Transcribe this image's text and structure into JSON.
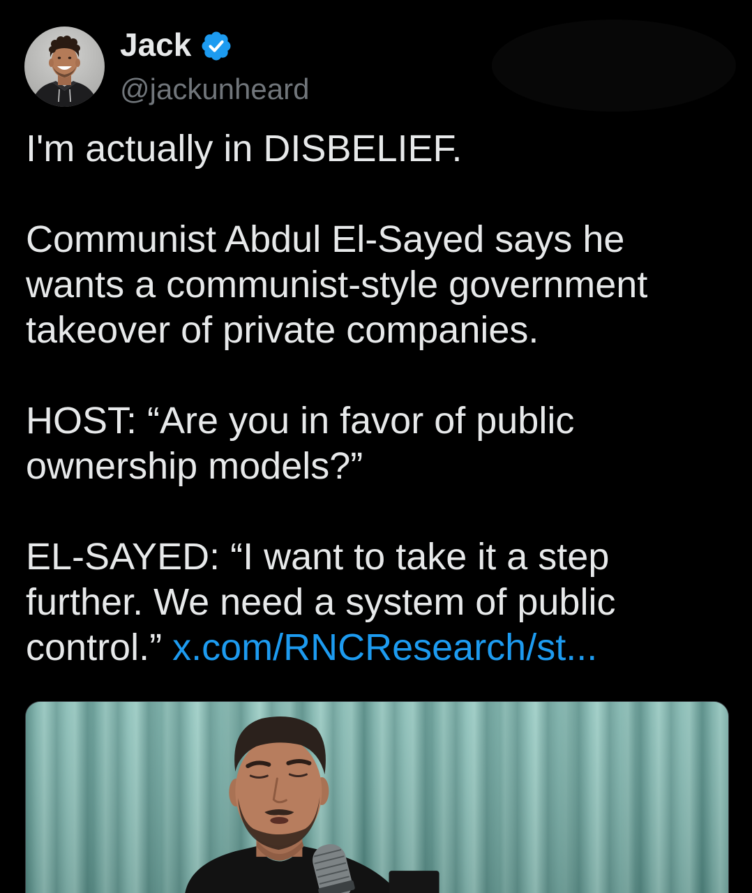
{
  "colors": {
    "background": "#000000",
    "text_primary": "#e7e9ea",
    "text_secondary": "#71767b",
    "link": "#1d9bf0",
    "verified_badge": "#1d9bf0"
  },
  "author": {
    "name": "Jack",
    "handle": "@jackunheard",
    "verified": true,
    "avatar_icon": "avatar-photo",
    "badge_icon": "verified-badge-icon"
  },
  "tweet": {
    "paragraphs": [
      [
        "I'm actually in DISBELIEF."
      ],
      [
        "Communist Abdul El-Sayed says he",
        "wants a communist-style government",
        "takeover of private companies."
      ],
      [
        "HOST: “Are you in favor of public",
        "ownership models?”"
      ],
      [
        "EL-SAYED: “I want to take it a step",
        "further. We need a system of public",
        "control.”"
      ]
    ],
    "link_text": "x.com/RNCResearch/st..."
  },
  "media": {
    "icon": "embedded-image"
  }
}
